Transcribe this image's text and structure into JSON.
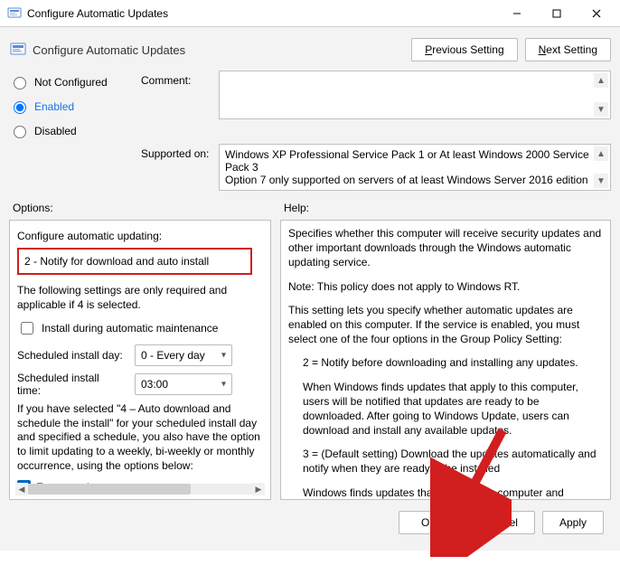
{
  "window": {
    "title": "Configure Automatic Updates"
  },
  "header": {
    "title": "Configure Automatic Updates",
    "prev": "Previous Setting",
    "next": "Next Setting"
  },
  "state": {
    "not_configured": "Not Configured",
    "enabled": "Enabled",
    "disabled": "Disabled"
  },
  "labels": {
    "comment": "Comment:",
    "supported_on": "Supported on:",
    "options": "Options:",
    "help": "Help:"
  },
  "supported_on": "Windows XP Professional Service Pack 1 or At least Windows 2000 Service Pack 3\nOption 7 only supported on servers of at least Windows Server 2016 edition",
  "options": {
    "configure_label": "Configure automatic updating:",
    "configure_value": "2 - Notify for download and auto install",
    "following_text": "The following settings are only required and applicable if 4 is selected.",
    "install_maint": "Install during automatic maintenance",
    "sched_day_label": "Scheduled install day:",
    "sched_day_value": "0 - Every day",
    "sched_time_label": "Scheduled install time:",
    "sched_time_value": "03:00",
    "note": "If you have selected \"4 – Auto download and schedule the install\" for your scheduled install day and specified a schedule, you also have the option to limit updating to a weekly, bi-weekly or monthly occurrence, using the options below:",
    "every_week": "Every week"
  },
  "help": {
    "p1": "Specifies whether this computer will receive security updates and other important downloads through the Windows automatic updating service.",
    "p2": "Note: This policy does not apply to Windows RT.",
    "p3": "This setting lets you specify whether automatic updates are enabled on this computer. If the service is enabled, you must select one of the four options in the Group Policy Setting:",
    "p4": "2 = Notify before downloading and installing any updates.",
    "p5": "When Windows finds updates that apply to this computer, users will be notified that updates are ready to be downloaded. After going to Windows Update, users can download and install any available updates.",
    "p6": "3 = (Default setting) Download the updates automatically and notify when they are ready to be installed",
    "p7": "Windows finds updates that apply to the computer and"
  },
  "footer": {
    "ok": "OK",
    "cancel": "Cancel",
    "apply": "Apply"
  }
}
